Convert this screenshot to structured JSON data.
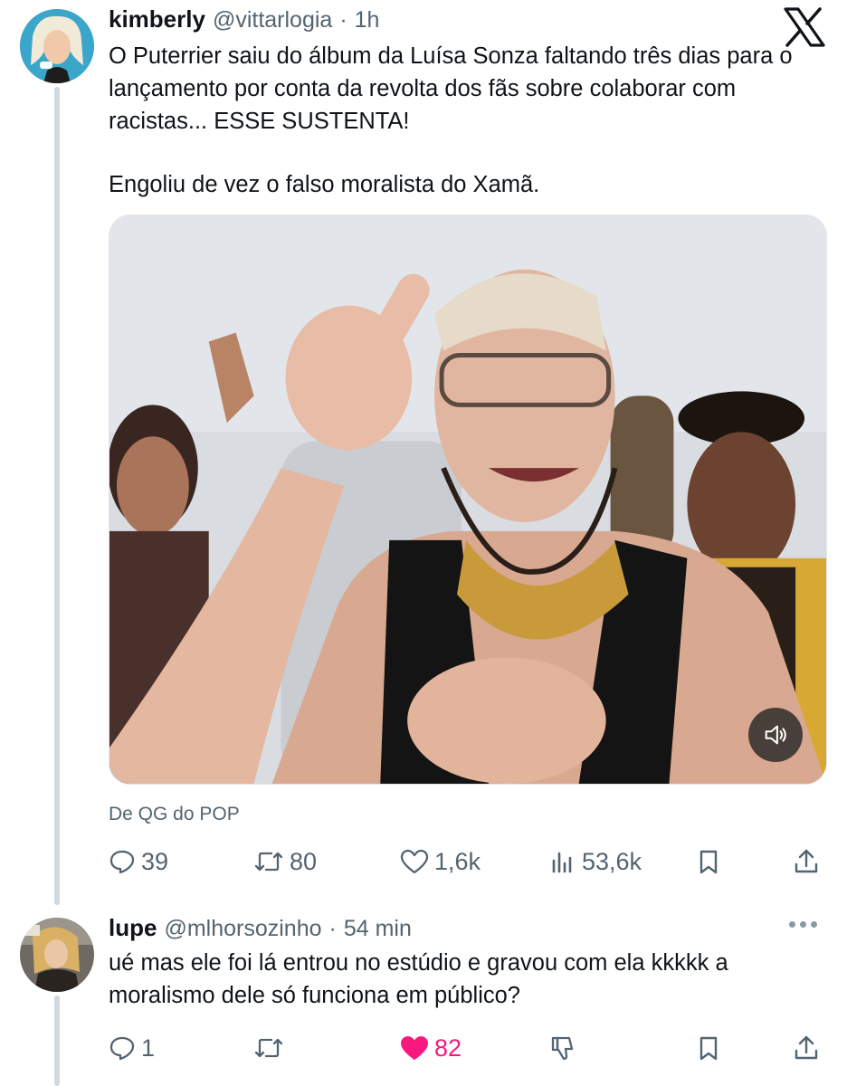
{
  "tweet": {
    "display_name": "kimberly",
    "handle": "@vittarlogia",
    "separator": "·",
    "time": "1h",
    "text_line_1": "O Puterrier saiu do álbum da Luísa Sonza faltando três dias para o lançamento por conta da revolta dos fãs sobre colaborar com racistas... ESSE SUSTENTA!",
    "text_line_2": "Engoliu de vez o falso moralista do Xamã.",
    "source": "De QG do POP",
    "stats": {
      "replies": "39",
      "reposts": "80",
      "likes": "1,6k",
      "views": "53,6k"
    }
  },
  "reply": {
    "display_name": "lupe",
    "handle": "@mlhorsozinho",
    "separator": "·",
    "time": "54 min",
    "text": "ué mas ele foi lá entrou no estúdio e gravou com ela kkkkk a moralismo dele só funciona em público?",
    "stats": {
      "replies": "1",
      "likes": "82"
    },
    "liked": true
  },
  "icons": {
    "platform": "x-logo-icon",
    "reply": "reply-icon",
    "repost": "repost-icon",
    "like": "heart-icon",
    "views": "views-icon",
    "bookmark": "bookmark-icon",
    "share": "share-icon",
    "dislike": "dislike-icon",
    "sound": "speaker-icon",
    "more": "more-icon"
  },
  "colors": {
    "text": "#0f1419",
    "muted": "#536471",
    "like": "#f91880",
    "thread": "#cfd9de"
  }
}
